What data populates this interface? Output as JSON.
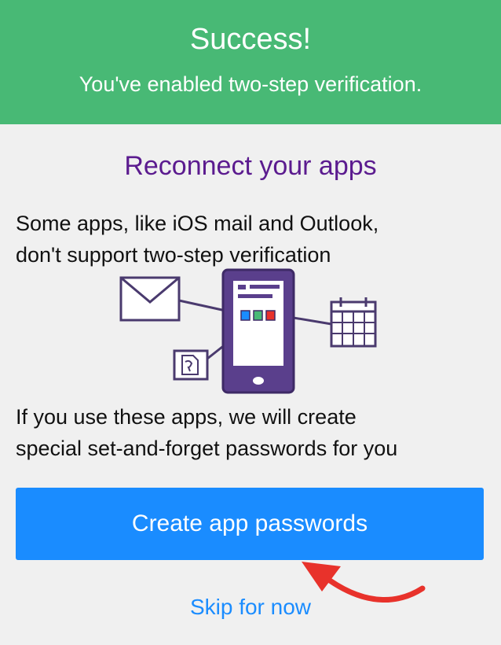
{
  "banner": {
    "title": "Success!",
    "subtitle": "You've enabled two-step verification."
  },
  "main": {
    "section_title": "Reconnect your apps",
    "intro_line_1": "Some apps, like iOS mail and Outlook,",
    "intro_line_2": "don't support two-step verification",
    "illustration": {
      "icons": [
        "mail-envelope-icon",
        "phone-icon",
        "calendar-icon",
        "contacts-icon"
      ]
    },
    "info_line_1": "If you use these apps, we will create",
    "info_line_2": "special set-and-forget passwords for you"
  },
  "actions": {
    "primary_label": "Create app passwords",
    "secondary_label": "Skip for now"
  },
  "colors": {
    "banner_green": "#48b975",
    "title_purple": "#5b1b8f",
    "primary_blue": "#1a8cff",
    "illustration_purple": "#5a3f8c",
    "annotation_red": "#e8322b"
  }
}
